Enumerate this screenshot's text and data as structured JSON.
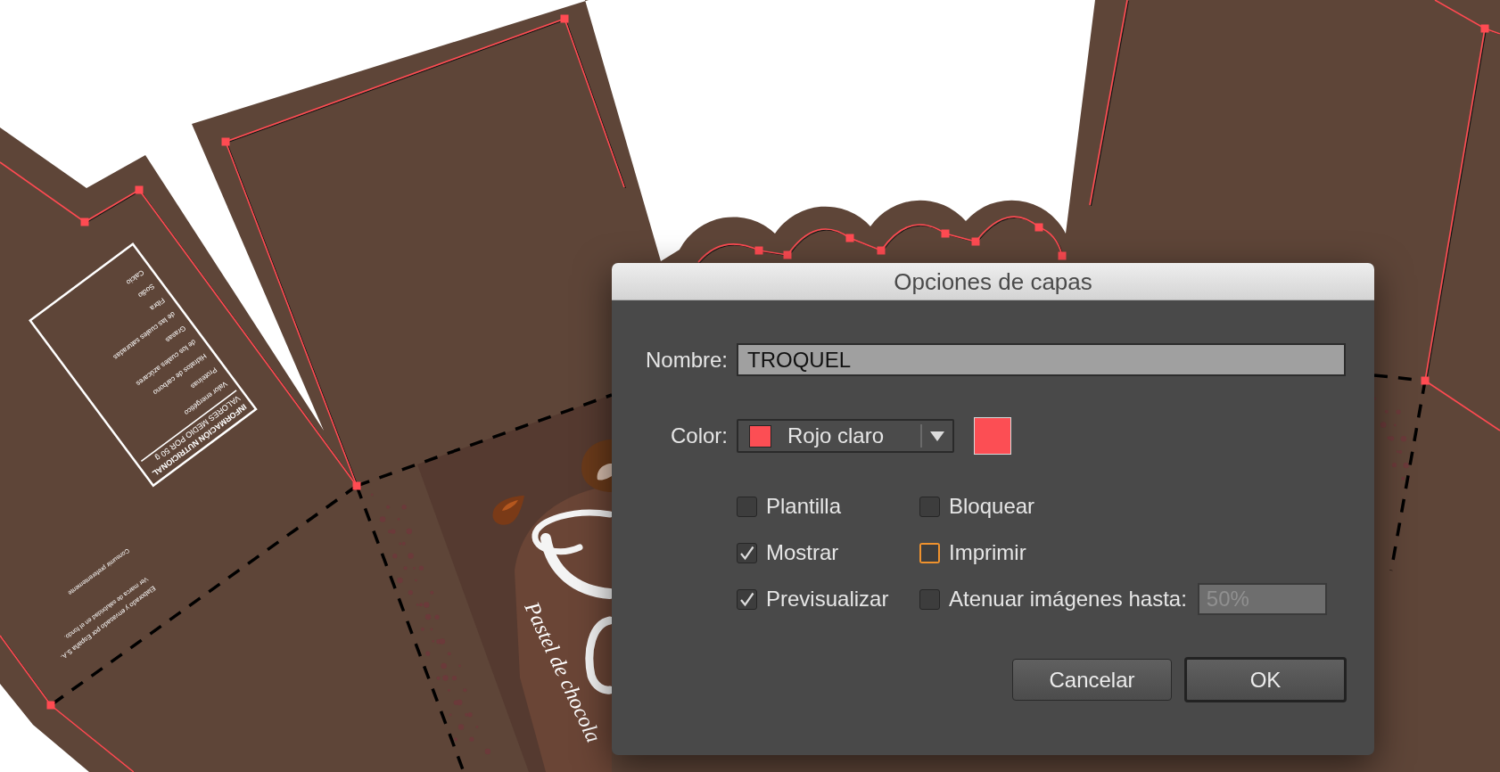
{
  "canvas": {
    "nutrition_label": {
      "title": "INFORMACIÓN NUTRICIONAL",
      "subtitle": "VALORES MEDIO POR 50 g",
      "rows": [
        "Valor energético",
        "Proteínas",
        "Hidratos de carbono",
        "de los cuales azúcares",
        "Grasas",
        "de las cuales saturadas",
        "Fibra",
        "Sodio",
        "Calcio"
      ]
    },
    "notes": [
      "Elaborado y envasado por España S.A.",
      "Ver marca de salubridad en el fondo.",
      "Consumir preferentemente"
    ],
    "tagline": "Pastel de chocola"
  },
  "dialog": {
    "title": "Opciones de capas",
    "name_field": {
      "label": "Nombre:",
      "value": "TROQUEL"
    },
    "color_field": {
      "label": "Color:",
      "value": "Rojo claro",
      "color": "#fc4e54"
    },
    "options": [
      {
        "label": "Plantilla",
        "checked": false,
        "focused": false
      },
      {
        "label": "Bloquear",
        "checked": false,
        "focused": false
      },
      {
        "label": "Mostrar",
        "checked": true,
        "focused": false
      },
      {
        "label": "Imprimir",
        "checked": false,
        "focused": true
      },
      {
        "label": "Previsualizar",
        "checked": true,
        "focused": false
      },
      {
        "label": "Atenuar imágenes hasta:",
        "checked": false,
        "focused": false,
        "field": {
          "value": "50%",
          "disabled": true
        }
      }
    ],
    "buttons": [
      {
        "label": "Cancelar",
        "default": false
      },
      {
        "label": "OK",
        "default": true
      }
    ]
  }
}
